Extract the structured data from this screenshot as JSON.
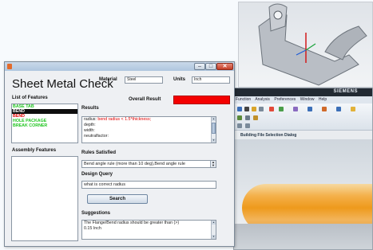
{
  "app": {
    "title": "Sheet Metal Check",
    "window_controls": {
      "minimize": "–",
      "maximize": "□",
      "close": "✕"
    }
  },
  "header": {
    "material_label": "Material",
    "material_value": "Steel",
    "units_label": "Units",
    "units_value": "Inch",
    "overall_result_label": "Overall Result",
    "overall_result_color": "#f40000"
  },
  "features": {
    "label": "List of Features",
    "items": [
      {
        "text": "BASE TAB",
        "color": "#1ec41e",
        "selected": false
      },
      {
        "text": "BEND",
        "color": "#ffffff",
        "selected": true
      },
      {
        "text": "BEND",
        "color": "#e00000",
        "selected": false
      },
      {
        "text": "HOLE PACKAGE",
        "color": "#1ec41e",
        "selected": false
      },
      {
        "text": "BREAK CORNER",
        "color": "#1ec41e",
        "selected": false
      }
    ]
  },
  "assembly": {
    "label": "Assembly Features"
  },
  "results": {
    "label": "Results",
    "line1_prefix": "radius: ",
    "line1_highlight": "bend radius < 1.5*thickness;",
    "lines": [
      "depth:",
      "width:",
      "neutralfactor:"
    ]
  },
  "rules": {
    "label": "Rules Satisfied",
    "selected": "Bend angle rule (more than 10 deg),Bend angle rule"
  },
  "query": {
    "label": "Design Query",
    "value": "what is correct radius",
    "button": "Search"
  },
  "suggestions": {
    "label": "Suggestions",
    "lines": [
      "The Flange/Bend radius should be greater than (>)",
      "0.15 Inch"
    ]
  },
  "cad": {
    "brand": "SIEMENS",
    "menu": [
      "Function",
      "Analysis",
      "Preferences",
      "Window",
      "Help"
    ],
    "dialog_label": "Building File Selection Dialog"
  }
}
